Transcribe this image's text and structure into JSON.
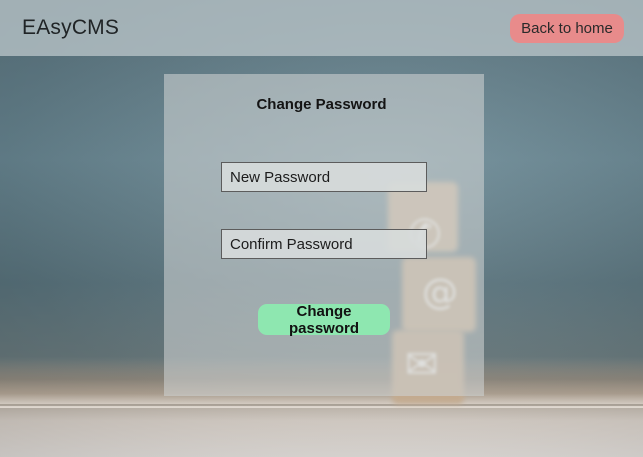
{
  "header": {
    "brand": "EAsyCMS",
    "back_label": "Back to home"
  },
  "form": {
    "title": "Change Password",
    "new_password_placeholder": "New Password",
    "confirm_password_placeholder": "Confirm Password",
    "submit_label": "Change password"
  },
  "colors": {
    "header_bg": "#b8c4c8",
    "back_button": "#e88b8b",
    "submit_button": "#8ee7b0",
    "card_bg": "#ced2d2"
  },
  "background": {
    "block_icons": [
      "phone-icon",
      "at-sign-icon",
      "envelope-icon"
    ]
  }
}
